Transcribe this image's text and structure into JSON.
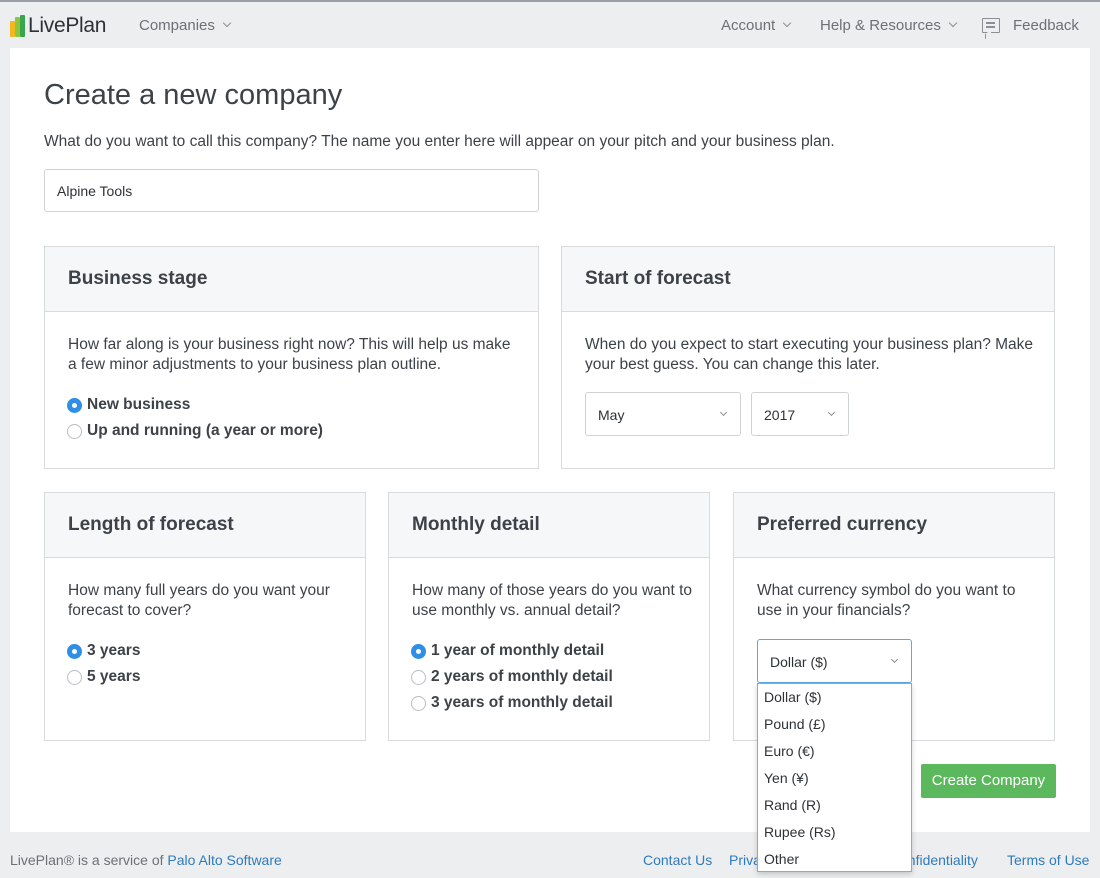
{
  "header": {
    "logo_text": "LivePlan",
    "companies_label": "Companies",
    "account_label": "Account",
    "help_label": "Help & Resources",
    "feedback_label": "Feedback"
  },
  "page": {
    "title": "Create a new company",
    "intro": "What do you want to call this company? The name you enter here will appear on your pitch and your business plan.",
    "company_name_value": "Alpine Tools"
  },
  "business_stage": {
    "title": "Business stage",
    "description": "How far along is your business right now? This will help us make a few minor adjustments to your business plan outline.",
    "options": [
      {
        "label": "New business",
        "selected": true
      },
      {
        "label": "Up and running (a year or more)",
        "selected": false
      }
    ]
  },
  "start_of_forecast": {
    "title": "Start of forecast",
    "description": "When do you expect to start executing your business plan? Make your best guess. You can change this later.",
    "month_value": "May",
    "year_value": "2017"
  },
  "length_of_forecast": {
    "title": "Length of forecast",
    "description": "How many full years do you want your forecast to cover?",
    "options": [
      {
        "label": "3 years",
        "selected": true
      },
      {
        "label": "5 years",
        "selected": false
      }
    ]
  },
  "monthly_detail": {
    "title": "Monthly detail",
    "description": "How many of those years do you want to use monthly vs. annual detail?",
    "options": [
      {
        "label": "1 year of monthly detail",
        "selected": true
      },
      {
        "label": "2 years of monthly detail",
        "selected": false
      },
      {
        "label": "3 years of monthly detail",
        "selected": false
      }
    ]
  },
  "preferred_currency": {
    "title": "Preferred currency",
    "description": "What currency symbol do you want to use in your financials?",
    "selected_value": "Dollar ($)",
    "options": [
      "Dollar ($)",
      "Pound (£)",
      "Euro (€)",
      "Yen (¥)",
      "Rand (R)",
      "Rupee (Rs)",
      "Other"
    ]
  },
  "actions": {
    "create_label": "Create Company"
  },
  "footer": {
    "service_prefix": "LivePlan® is a service of ",
    "service_link": "Palo Alto Software",
    "contact": "Contact Us",
    "privacy": "Priva",
    "confidentiality": "onfidentiality",
    "terms": "Terms of Use"
  },
  "colors": {
    "accent_blue": "#2f8fe6",
    "create_green": "#5cb85c",
    "link_blue": "#2f7bbf"
  }
}
